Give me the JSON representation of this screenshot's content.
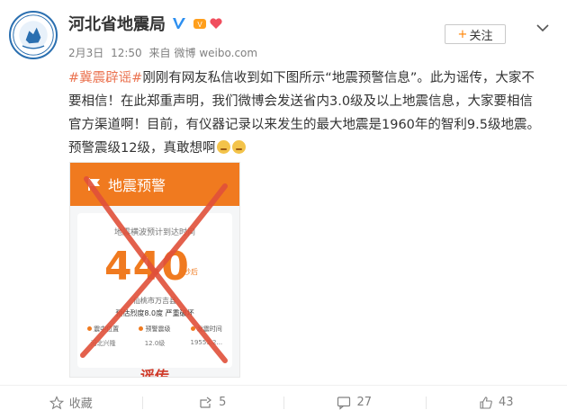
{
  "header": {
    "account_name": "河北省地震局",
    "follow_label": "关注",
    "follow_plus": "+"
  },
  "meta": {
    "date": "2月3日",
    "time": "12:50",
    "source_prefix": "来自",
    "source": "微博 weibo.com"
  },
  "post": {
    "hashtag": "#冀震辟谣#",
    "lines": [
      "刚刚有网友私信收到如下图所示“地震预警信息”。此为谣传，大家不",
      "要相信！在此郑重声明，我们微博会发送省内3.0级及以上地震信息，大家要相信",
      "官方渠道啊！目前，有仪器记录以来发生的最大地震是1960年的智利9.5级地震。",
      "预警震级12级，真敢想啊"
    ]
  },
  "image": {
    "header_title": "地震预警",
    "caption": "地震横波预计到达时间",
    "countdown": "440",
    "unit": "秒后",
    "location": "仙桃市万吉县",
    "intensity": "预估烈度8.0度 严重破坏",
    "stats": [
      {
        "label": "震中位置",
        "value": "河北兴隆"
      },
      {
        "label": "预警震级",
        "value": "12.0级"
      },
      {
        "label": "发震时间",
        "value": "19553.2..."
      }
    ],
    "stamp": "谣传"
  },
  "actions": [
    {
      "label": "收藏",
      "icon": "star-icon"
    },
    {
      "label": "5",
      "icon": "share-icon"
    },
    {
      "label": "27",
      "icon": "comment-icon"
    },
    {
      "label": "43",
      "icon": "like-icon"
    }
  ],
  "colors": {
    "orange": "#f07a1f",
    "hashtag": "#eb7350",
    "cross_red": "#e0503a",
    "verified_blue": "#2d8ff0"
  }
}
